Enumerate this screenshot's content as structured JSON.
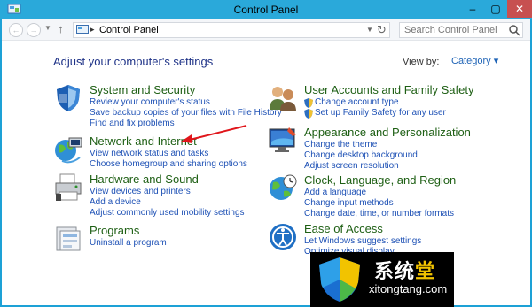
{
  "window": {
    "title": "Control Panel",
    "buttons": {
      "minimize": "–",
      "maximize": "▢",
      "close": "✕"
    }
  },
  "navbar": {
    "back": "←",
    "forward": "→",
    "up": "↑",
    "address_sep": "▸",
    "address": "Control Panel",
    "search_placeholder": "Search Control Panel"
  },
  "main": {
    "heading": "Adjust your computer's settings",
    "view_by_label": "View by:",
    "view_by_value": "Category ▾"
  },
  "categories": [
    {
      "title": "System and Security",
      "icon": "shield-icon",
      "links": [
        "Review your computer's status",
        "Save backup copies of your files with File History",
        "Find and fix problems"
      ]
    },
    {
      "title": "Network and Internet",
      "icon": "globe-network-icon",
      "links": [
        "View network status and tasks",
        "Choose homegroup and sharing options"
      ]
    },
    {
      "title": "Hardware and Sound",
      "icon": "printer-icon",
      "links": [
        "View devices and printers",
        "Add a device",
        "Adjust commonly used mobility settings"
      ]
    },
    {
      "title": "Programs",
      "icon": "programs-icon",
      "links": [
        "Uninstall a program"
      ]
    },
    {
      "title": "User Accounts and Family Safety",
      "icon": "users-icon",
      "links": [
        "Change account type",
        "Set up Family Safety for any user"
      ]
    },
    {
      "title": "Appearance and Personalization",
      "icon": "monitor-icon",
      "links": [
        "Change the theme",
        "Change desktop background",
        "Adjust screen resolution"
      ]
    },
    {
      "title": "Clock, Language, and Region",
      "icon": "clock-globe-icon",
      "links": [
        "Add a language",
        "Change input methods",
        "Change date, time, or number formats"
      ]
    },
    {
      "title": "Ease of Access",
      "icon": "ease-of-access-icon",
      "links": [
        "Let Windows suggest settings",
        "Optimize visual display"
      ]
    }
  ],
  "watermark": {
    "text_main": "系统",
    "text_highlight": "堂",
    "url": "xitongtang.com"
  },
  "colors": {
    "title_bar": "#2aa9da",
    "category_title": "#1e5f14",
    "link": "#1e51b5",
    "annotation_arrow": "#e0161b"
  }
}
